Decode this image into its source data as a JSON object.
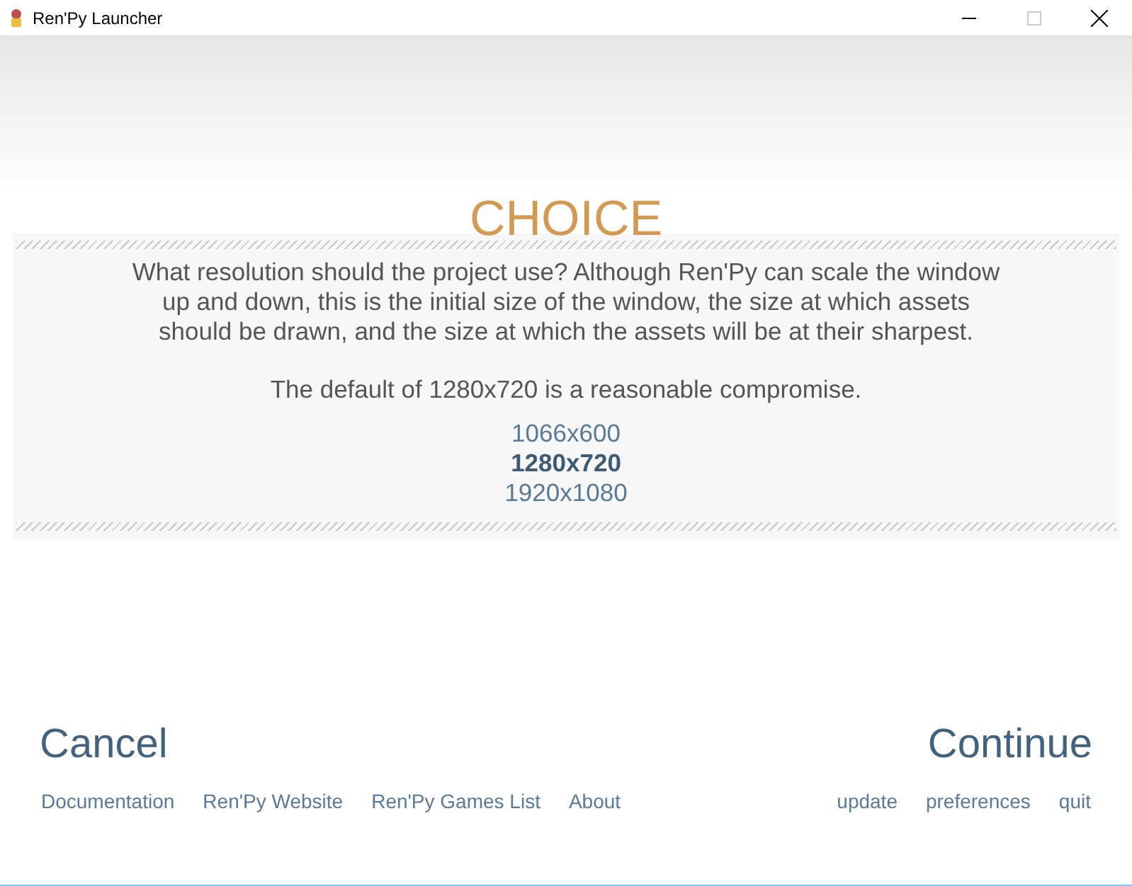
{
  "window": {
    "title": "Ren'Py Launcher"
  },
  "heading": "CHOICE",
  "message_lines": [
    "What resolution should the project use? Although Ren'Py can scale the window",
    "up and down, this is the initial size of the window, the size at which assets",
    "should be drawn, and the size at which the assets will be at their sharpest."
  ],
  "note": "The default of 1280x720 is a reasonable compromise.",
  "options": [
    {
      "label": "1066x600",
      "selected": false
    },
    {
      "label": "1280x720",
      "selected": true
    },
    {
      "label": "1920x1080",
      "selected": false
    }
  ],
  "cancel": "Cancel",
  "continue": "Continue",
  "left_links": [
    "Documentation",
    "Ren'Py Website",
    "Ren'Py Games List",
    "About"
  ],
  "right_links": [
    "update",
    "preferences",
    "quit"
  ]
}
